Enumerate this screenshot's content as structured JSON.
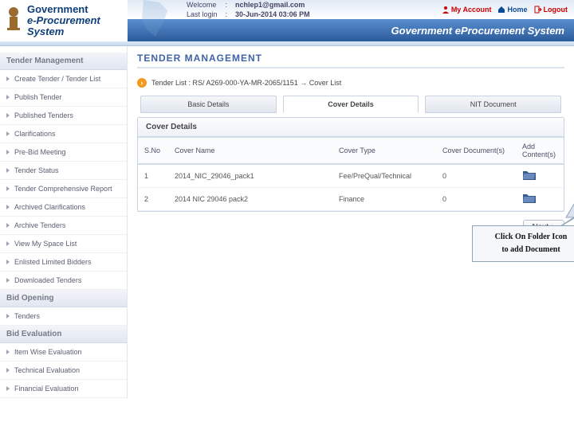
{
  "header": {
    "brand_line1": "Government",
    "brand_line2": "e-Procurement",
    "brand_line3": "System",
    "welcome_label": "Welcome",
    "lastlogin_label": "Last login",
    "user_email": "nchlep1@gmail.com",
    "lastlogin_value": "30-Jun-2014 03:06 PM",
    "links": {
      "account": "My Account",
      "home": "Home",
      "logout": "Logout"
    },
    "banner": "Government eProcurement System"
  },
  "page_title": "TENDER MANAGEMENT",
  "breadcrumb": "Tender List : RS/ A269-000-YA-MR-2065/1151 → Cover List",
  "tabs": [
    "Basic Details",
    "Cover Details",
    "NIT Document"
  ],
  "active_tab": 1,
  "panel_title": "Cover Details",
  "columns": [
    "S.No",
    "Cover Name",
    "Cover Type",
    "Cover Document(s)",
    "Add Content(s)"
  ],
  "rows": [
    {
      "sno": "1",
      "name": "2014_NIC_29046_pack1",
      "type": "Fee/PreQual/Technical",
      "docs": "0"
    },
    {
      "sno": "2",
      "name": "2014 NIC 29046 pack2",
      "type": "Finance",
      "docs": "0"
    }
  ],
  "next_label": "Next",
  "callout_line1": "Click On Folder Icon",
  "callout_line2": "to add Document",
  "sidebar": {
    "sections": [
      {
        "title": "Tender Management",
        "items": [
          "Create Tender / Tender List",
          "Publish Tender",
          "Published Tenders",
          "Clarifications",
          "Pre-Bid Meeting",
          "Tender Status",
          "Tender Comprehensive Report",
          "Archived Clarifications",
          "Archive Tenders",
          "View My Space List",
          "Enlisted Limited Bidders",
          "Downloaded Tenders"
        ]
      },
      {
        "title": "Bid Opening",
        "items": [
          "Tenders"
        ]
      },
      {
        "title": "Bid Evaluation",
        "items": [
          "Item Wise Evaluation",
          "Technical Evaluation",
          "Financial Evaluation"
        ]
      }
    ]
  }
}
